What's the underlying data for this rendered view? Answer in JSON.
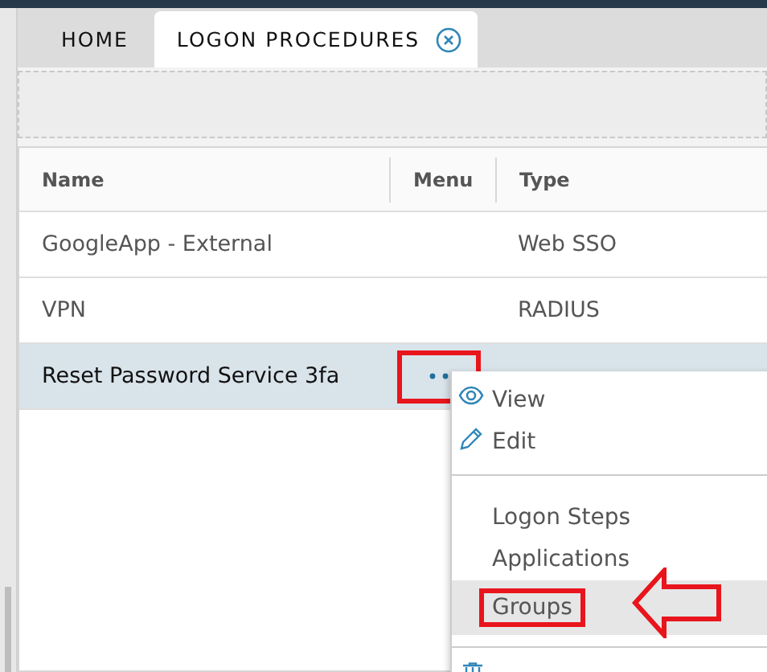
{
  "tabs": [
    {
      "label": "HOME",
      "selected": false,
      "closable": false
    },
    {
      "label": "LOGON PROCEDURES",
      "selected": true,
      "closable": true
    }
  ],
  "table": {
    "columns": [
      "Name",
      "Menu",
      "Type"
    ],
    "rows": [
      {
        "name": "GoogleApp - External",
        "type": "Web SSO",
        "selected": false,
        "menu_open": false,
        "annotated": false
      },
      {
        "name": "VPN",
        "type": "RADIUS",
        "selected": false,
        "menu_open": false,
        "annotated": false
      },
      {
        "name": "Reset Password Service 3fa",
        "selected": true,
        "menu_open": true,
        "annotated": true
      }
    ]
  },
  "context_menu": {
    "items": [
      {
        "kind": "icon_item",
        "label": "View",
        "selected": false,
        "annotated": false
      },
      {
        "kind": "icon_item",
        "label": "Edit",
        "selected": false,
        "annotated": false
      },
      {
        "kind": "divider"
      },
      {
        "kind": "item",
        "label": "Logon Steps",
        "selected": false,
        "annotated": false
      },
      {
        "kind": "item",
        "label": "Applications",
        "selected": false,
        "annotated": false
      },
      {
        "kind": "item",
        "label": "Groups",
        "selected": true,
        "annotated": true
      },
      {
        "kind": "divider"
      },
      {
        "kind": "icon_only"
      }
    ]
  }
}
